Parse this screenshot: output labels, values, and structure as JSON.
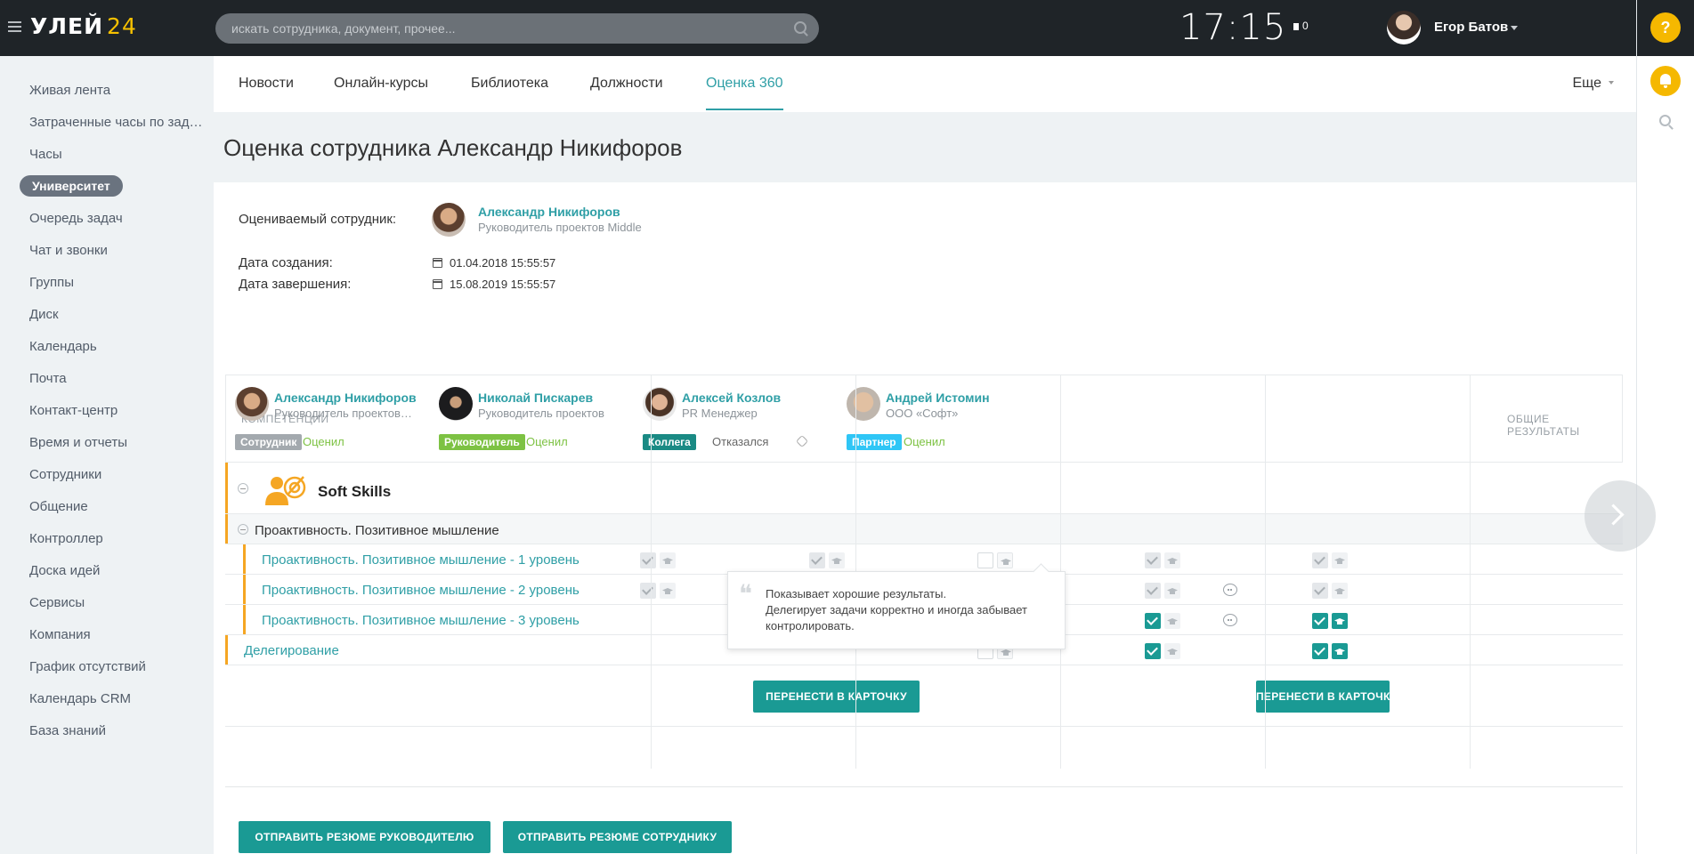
{
  "header": {
    "logo_text": "УЛЕЙ",
    "logo_num": "24",
    "search_placeholder": "искать сотрудника, документ, прочее...",
    "clock": "17:15",
    "flag_count": "0",
    "user_name": "Егор Батов"
  },
  "rail": {
    "help": "?"
  },
  "sidebar": {
    "items": [
      {
        "label": "Живая лента"
      },
      {
        "label": "Затраченные часы по задачам"
      },
      {
        "label": "Часы"
      },
      {
        "label": "Университет",
        "active": true
      },
      {
        "label": "Очередь задач"
      },
      {
        "label": "Чат и звонки"
      },
      {
        "label": "Группы"
      },
      {
        "label": "Диск"
      },
      {
        "label": "Календарь"
      },
      {
        "label": "Почта"
      },
      {
        "label": "Контакт-центр"
      },
      {
        "label": "Время и отчеты"
      },
      {
        "label": "Сотрудники"
      },
      {
        "label": "Общение"
      },
      {
        "label": "Контроллер"
      },
      {
        "label": "Доска идей"
      },
      {
        "label": "Сервисы"
      },
      {
        "label": "Компания"
      },
      {
        "label": "График отсутствий"
      },
      {
        "label": "Календарь CRM"
      },
      {
        "label": "База знаний"
      }
    ]
  },
  "tabs": {
    "items": [
      {
        "label": "Новости"
      },
      {
        "label": "Онлайн-курсы"
      },
      {
        "label": "Библиотека"
      },
      {
        "label": "Должности"
      },
      {
        "label": "Оценка 360",
        "active": true
      }
    ],
    "more": "Еще"
  },
  "page": {
    "title": "Оценка сотрудника Александр Никифоров",
    "employee_label": "Оцениваемый сотрудник:",
    "employee_name": "Александр Никифоров",
    "employee_position": "Руководитель проектов Middle",
    "created_label": "Дата создания:",
    "created_value": "01.04.2018 15:55:57",
    "finished_label": "Дата завершения:",
    "finished_value": "15.08.2019 15:55:57"
  },
  "table": {
    "competencies_header": "КОМПЕТЕНЦИИ",
    "total_header": "ОБЩИЕ РЕЗУЛЬТАТЫ",
    "reviewers": [
      {
        "name": "Александр Никифоров",
        "position": "Руководитель проектов Middle",
        "role": "Сотрудник",
        "role_color": "#a3a9ae",
        "status": "Оценил",
        "status_color": "#7dc243"
      },
      {
        "name": "Николай Пискарев",
        "position": "Руководитель проектов",
        "role": "Руководитель",
        "role_color": "#7dc243",
        "status": "Оценил",
        "status_color": "#7dc243"
      },
      {
        "name": "Алексей Козлов",
        "position": "PR Менеджер",
        "role": "Коллега",
        "role_color": "#1a8a84",
        "status": "Отказался",
        "status_color": "#666666"
      },
      {
        "name": "Андрей Истомин",
        "position": "ООО «Софт»",
        "role": "Партнер",
        "role_color": "#2fc6f6",
        "status": "Оценил",
        "status_color": "#7dc243"
      }
    ],
    "group_title": "Soft Skills",
    "subgroup_title": "Проактивность. Позитивное мышление",
    "levels": [
      {
        "title": "Проактивность. Позитивное мышление - 1 уровень"
      },
      {
        "title": "Проактивность. Позитивное мышление - 2 уровень"
      },
      {
        "title": "Проактивность. Позитивное мышление - 3 уровень"
      }
    ],
    "delegation_title": "Делегирование",
    "transfer_button": "ПЕРЕНЕСТИ В КАРТОЧКУ",
    "transfer_button_total": "ПЕРЕНЕСТИ В КАРТОЧКУ"
  },
  "tooltip": {
    "line1": "Показывает хорошие результаты.",
    "line2": "Делегирует задачи корректно и иногда забывает",
    "line3": "контролировать."
  },
  "actions": {
    "send_manager": "ОТПРАВИТЬ РЕЗЮМЕ РУКОВОДИТЕЛЮ",
    "send_employee": "ОТПРАВИТЬ РЕЗЮМЕ СОТРУДНИКУ"
  }
}
